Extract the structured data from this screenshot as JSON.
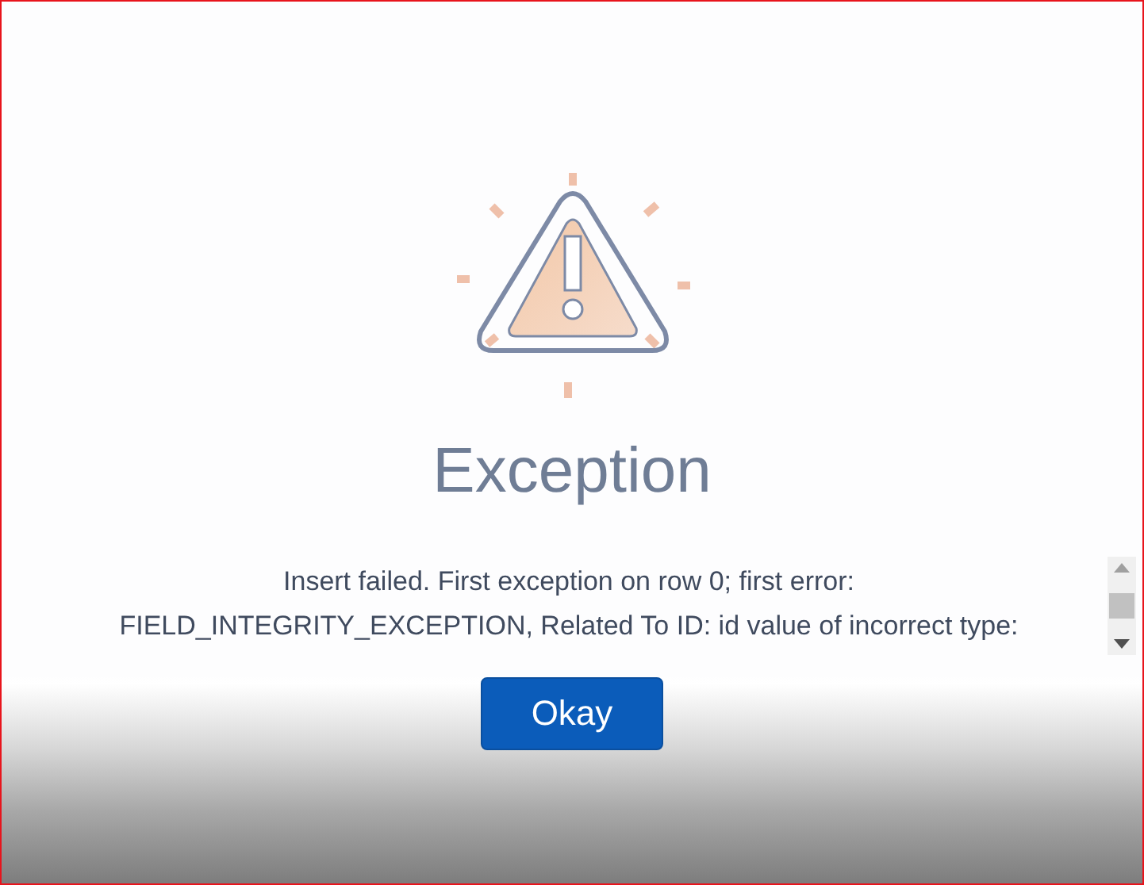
{
  "dialog": {
    "title": "Exception",
    "message": "Insert failed. First exception on row 0; first error:\nFIELD_INTEGRITY_EXCEPTION, Related To ID: id value of incorrect type:",
    "buttons": [
      {
        "label": "Okay",
        "kind": "primary"
      }
    ]
  }
}
